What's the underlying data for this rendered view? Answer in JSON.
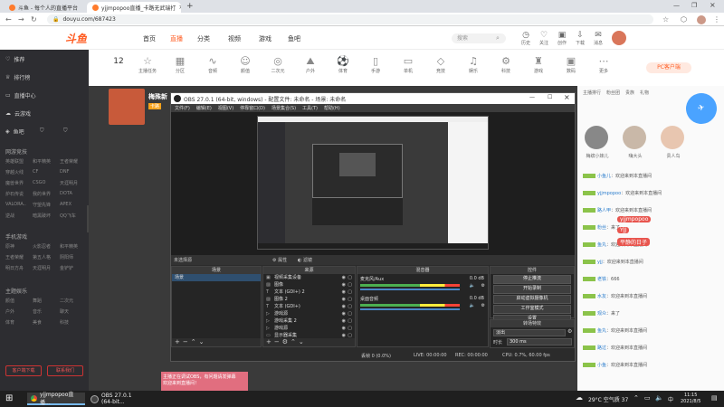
{
  "browser": {
    "tabs": [
      {
        "label": "斗鱼 - 每个人的直播平台",
        "active": false
      },
      {
        "label": "yjjmpopoo直播_卡路无武瑞打",
        "active": true
      }
    ],
    "new_tab": "+",
    "url": "douyu.com/687423"
  },
  "douyu": {
    "logo": "斗鱼",
    "nav": [
      "首页",
      "直播",
      "分类",
      "视频",
      "游戏",
      "鱼吧"
    ],
    "active_nav": "直播",
    "search_placeholder": "搜索",
    "header_icons": [
      "历史",
      "关注",
      "创作",
      "下载",
      "消息"
    ],
    "categories": [
      "主播任务",
      "分区",
      "音频",
      "颜值",
      "二次元",
      "户外",
      "体育",
      "手游",
      "单机",
      "竞技",
      "娱乐",
      "科技",
      "游戏",
      "数码",
      "更多"
    ],
    "follow_count": "12",
    "pc_badge": "PC客户端"
  },
  "sidebar": {
    "items": [
      "推荐",
      "排行榜",
      "直播中心",
      "云游戏",
      "鱼吧"
    ],
    "section_online": "网游竞技",
    "online_grid": [
      "英雄联盟",
      "和平精英",
      "王者荣耀",
      "穿越火线",
      "CF",
      "DNF",
      "魔兽世界",
      "CSGO",
      "天涯明月",
      "炉石传说",
      "我的世界",
      "DOTA",
      "VALORA..",
      "守望先锋",
      "APEX",
      "逆战",
      "暗黑破坏",
      "QQ飞车"
    ],
    "section_mobile": "手机游戏",
    "mobile_grid": [
      "原神",
      "火影忍者",
      "和平精英",
      "王者荣耀",
      "第五人格",
      "阴阳师",
      "明日方舟",
      "天涯明月",
      "金铲铲"
    ],
    "section_ent": "主题娱乐",
    "ent_grid": [
      "颜值",
      "舞蹈",
      "二次元",
      "户外",
      "音乐",
      "聊天",
      "体育",
      "美食",
      "科技"
    ],
    "btn_left": "客户端下载",
    "btn_right": "联系我们"
  },
  "stream": {
    "streamer_name": "梅殊新",
    "tag": "卡路",
    "overlay_lines": [
      "主播正在调试OBS，有问题请发弹幕",
      "欢迎来到直播间！"
    ]
  },
  "obs": {
    "title": "OBS 27.0.1 (64-bit, windows) - 配置文件: 未命名 - 场景: 未命名",
    "menu": [
      "文件(F)",
      "编辑(E)",
      "视图(V)",
      "停靠窗口(D)",
      "场景集合(S)",
      "工具(T)",
      "帮助(H)"
    ],
    "no_source": "未选择源",
    "props": "属性",
    "filters": "滤镜",
    "scenes_header": "场景",
    "scenes": [
      "场景"
    ],
    "sources_header": "来源",
    "sources": [
      "视频采集设备",
      "图像",
      "文本 (GDI+) 2",
      "图像 2",
      "文本 (GDI+)",
      "游戏源",
      "游戏采集 2",
      "游戏源",
      "显示器采集"
    ],
    "mixer_header": "混音器",
    "mixer": [
      {
        "name": "麦克风/Aux",
        "db": "0.0 dB"
      },
      {
        "name": "桌面音频",
        "db": "0.0 dB"
      }
    ],
    "controls_header": "控件",
    "controls": [
      "停止推流",
      "开始录制",
      "启动虚拟摄像机",
      "工作室模式",
      "设置",
      "退出"
    ],
    "transition_header": "转场特效",
    "transition_value": "淡出",
    "duration_label": "时长",
    "duration_value": "300 ms",
    "status": {
      "dropped": "丢帧 0 (0.0%)",
      "live": "LIVE: 00:00:00",
      "rec": "REC: 00:00:00",
      "cpu": "CPU: 0.7%, 60.00 fps"
    }
  },
  "chat": {
    "gift_bar": [
      "主播排行",
      "粉丝团",
      "贵族",
      "礼物"
    ],
    "viewers": [
      {
        "name": "梅缤小妹儿"
      },
      {
        "name": "嗨大头"
      },
      {
        "name": "贵人鸟"
      }
    ],
    "lines": [
      {
        "badge": "",
        "user": "小鱼儿",
        "text": "欢迎来到本直播间"
      },
      {
        "badge": "",
        "user": "yjjmpopoo",
        "text": "欢迎来到本直播间"
      },
      {
        "badge": "",
        "user": "路人甲",
        "text": "欢迎来到本直播间"
      },
      {
        "badge": "",
        "user": "粉丝",
        "text": "来了"
      },
      {
        "badge": "",
        "user": "鱼丸",
        "text": "欢迎来到本直播间"
      },
      {
        "badge": "",
        "user": "yjj",
        "text": "欢迎来到本直播间"
      },
      {
        "badge": "",
        "user": "老铁",
        "text": "666"
      },
      {
        "badge": "",
        "user": "水友",
        "text": "欢迎来到本直播间"
      },
      {
        "badge": "",
        "user": "观众",
        "text": "来了"
      },
      {
        "badge": "",
        "user": "鱼丸",
        "text": "欢迎来到本直播间"
      },
      {
        "badge": "",
        "user": "路过",
        "text": "欢迎来到本直播间"
      },
      {
        "badge": "",
        "user": "小鱼",
        "text": "欢迎来到本直播间"
      }
    ],
    "float_tags": [
      "yjjmpopoo",
      "YJJ",
      "平静的日子"
    ]
  },
  "taskbar": {
    "items": [
      {
        "label": "yjjmpopoo直播..."
      },
      {
        "label": "OBS 27.0.1 (64-bit..."
      }
    ],
    "weather": "29°C 空气质 37",
    "time": "11:15",
    "date": "2021/8/5",
    "lang": "中"
  }
}
